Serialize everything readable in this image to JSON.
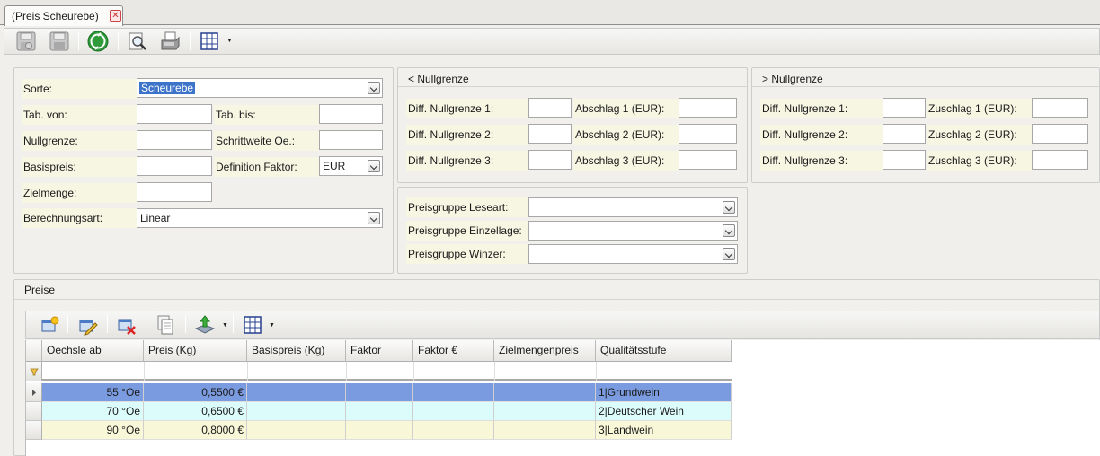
{
  "tab": {
    "title": "(Preis Scheurebe)"
  },
  "toolbar": {
    "icons": [
      "save-disabled-icon",
      "save-icon",
      "sync-icon",
      "print-preview-icon",
      "print-icon",
      "grid-layout-icon"
    ]
  },
  "form": {
    "sorte": {
      "label": "Sorte:",
      "value": "Scheurebe"
    },
    "tab_von": {
      "label": "Tab. von:",
      "value": ""
    },
    "tab_bis": {
      "label": "Tab. bis:",
      "value": ""
    },
    "nullgrenze": {
      "label": "Nullgrenze:",
      "value": ""
    },
    "schrittweite": {
      "label": "Schrittweite Oe.:",
      "value": ""
    },
    "basispreis": {
      "label": "Basispreis:",
      "value": ""
    },
    "definition_faktor": {
      "label": "Definition Faktor:",
      "value": "EUR"
    },
    "zielmenge": {
      "label": "Zielmenge:",
      "value": ""
    },
    "berechnungsart": {
      "label": "Berechnungsart:",
      "value": "Linear"
    }
  },
  "lower_null": {
    "title": "< Nullgrenze",
    "diff1": "Diff. Nullgrenze 1:",
    "diff2": "Diff. Nullgrenze 2:",
    "diff3": "Diff. Nullgrenze 3:",
    "ab1": "Abschlag 1 (EUR):",
    "ab2": "Abschlag 2 (EUR):",
    "ab3": "Abschlag 3 (EUR):"
  },
  "upper_null": {
    "title": "> Nullgrenze",
    "diff1": "Diff. Nullgrenze 1:",
    "diff2": "Diff. Nullgrenze 2:",
    "diff3": "Diff. Nullgrenze 3:",
    "zu1": "Zuschlag 1 (EUR):",
    "zu2": "Zuschlag 2 (EUR):",
    "zu3": "Zuschlag 3 (EUR):"
  },
  "preisgruppen": {
    "leseart": {
      "label": "Preisgruppe Leseart:",
      "value": ""
    },
    "einzellage": {
      "label": "Preisgruppe Einzellage:",
      "value": ""
    },
    "winzer": {
      "label": "Preisgruppe Winzer:",
      "value": ""
    }
  },
  "preise": {
    "title": "Preise",
    "columns": [
      "Oechsle ab",
      "Preis (Kg)",
      "Basispreis (Kg)",
      "Faktor",
      "Faktor €",
      "Zielmengenpreis",
      "Qualitätsstufe"
    ],
    "rows": [
      {
        "oechsle": "55 °Oe",
        "preis": "0,5500 €",
        "basispreis": "",
        "faktor": "",
        "faktor_eur": "",
        "zielmengenpreis": "",
        "qualitaet": "1|Grundwein"
      },
      {
        "oechsle": "70 °Oe",
        "preis": "0,6500 €",
        "basispreis": "",
        "faktor": "",
        "faktor_eur": "",
        "zielmengenpreis": "",
        "qualitaet": "2|Deutscher Wein"
      },
      {
        "oechsle": "90 °Oe",
        "preis": "0,8000 €",
        "basispreis": "",
        "faktor": "",
        "faktor_eur": "",
        "zielmengenpreis": "",
        "qualitaet": "3|Landwein"
      }
    ],
    "row_colors": [
      "#7b9be0",
      "#dcfbfb",
      "#f8f7d8"
    ],
    "toolbar_icons": [
      "new-record-icon",
      "edit-icon",
      "delete-icon",
      "copy-icon",
      "export-icon",
      "grid-layout-icon"
    ]
  }
}
